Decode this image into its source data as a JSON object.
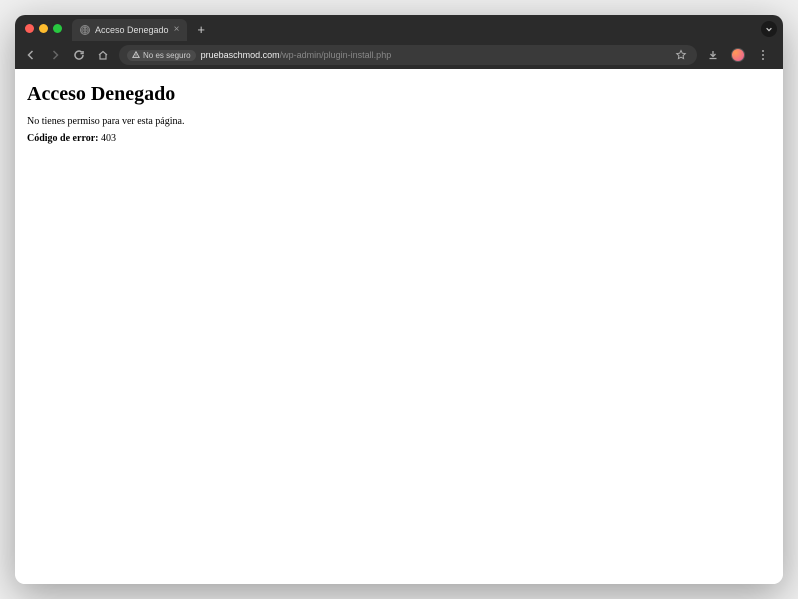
{
  "tab": {
    "title": "Acceso Denegado"
  },
  "toolbar": {
    "security_label": "No es seguro",
    "url_domain": "pruebaschmod.com",
    "url_path": "/wp-admin/plugin-install.php"
  },
  "page": {
    "heading": "Acceso Denegado",
    "message": "No tienes permiso para ver esta página.",
    "error_label": "Código de error:",
    "error_code": "403"
  }
}
